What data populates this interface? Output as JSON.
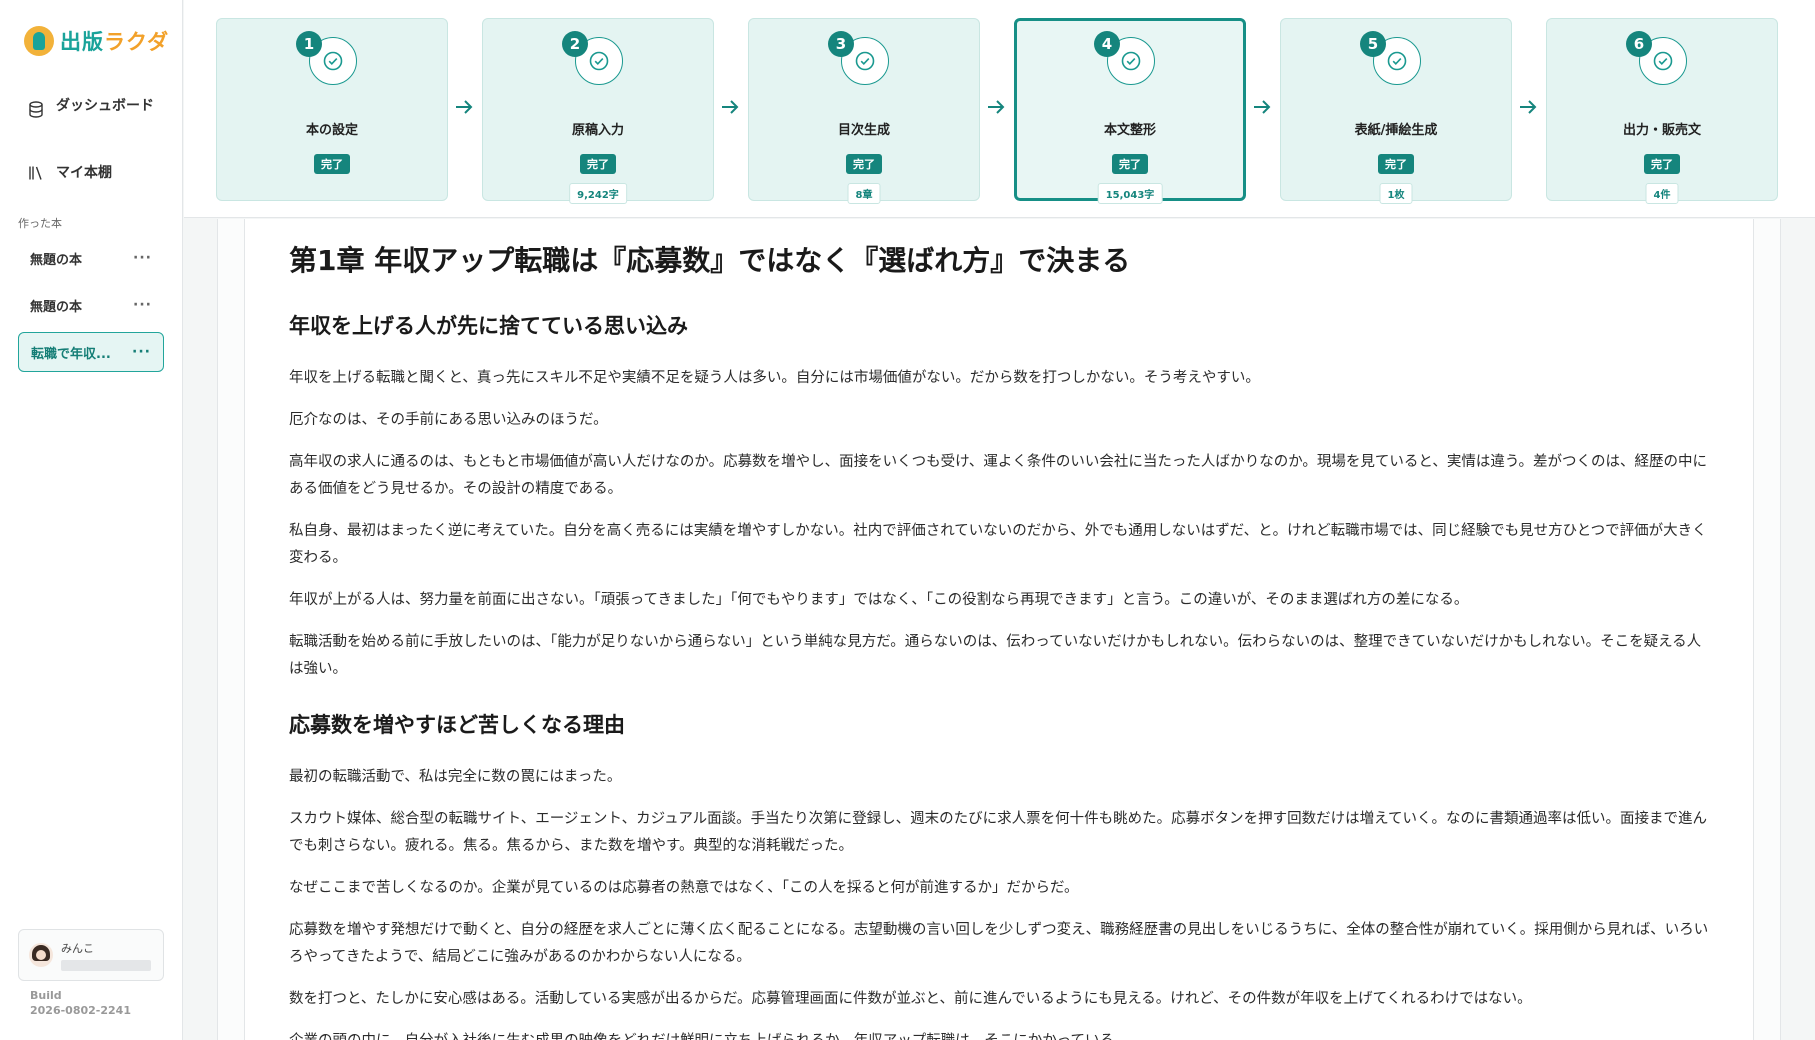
{
  "app": {
    "logo_main": "出版",
    "logo_accent": "ラクダ"
  },
  "sidebar": {
    "nav": [
      {
        "label": "ダッシュボード",
        "icon": "database-icon"
      },
      {
        "label": "マイ本棚",
        "icon": "bookshelf-icon"
      }
    ],
    "section_label": "作った本",
    "books": [
      {
        "label": "無題の本",
        "more": "···"
      },
      {
        "label": "無題の本",
        "more": "···"
      },
      {
        "label": "転職で年収...",
        "more": "···"
      }
    ],
    "user": {
      "name": "みんこ"
    },
    "build_label": "Build",
    "build_value": "2026-0802-2241"
  },
  "steps": [
    {
      "num": "1",
      "title": "本の設定",
      "status": "完了",
      "count": ""
    },
    {
      "num": "2",
      "title": "原稿入力",
      "status": "完了",
      "count": "9,242字"
    },
    {
      "num": "3",
      "title": "目次生成",
      "status": "完了",
      "count": "8章"
    },
    {
      "num": "4",
      "title": "本文整形",
      "status": "完了",
      "count": "15,043字"
    },
    {
      "num": "5",
      "title": "表紙/挿絵生成",
      "status": "完了",
      "count": "1枚"
    },
    {
      "num": "6",
      "title": "出力・販売文",
      "status": "完了",
      "count": "4件"
    }
  ],
  "colors": {
    "accent": "#15857d",
    "step_bg": "#e4f4f2",
    "logo_orange": "#f2a12a"
  },
  "document": {
    "chapter_title": "第1章 年収アップ転職は『応募数』ではなく『選ばれ方』で決まる",
    "section1_title": "年収を上げる人が先に捨てている思い込み",
    "section1_paragraphs": [
      "年収を上げる転職と聞くと、真っ先にスキル不足や実績不足を疑う人は多い。自分には市場価値がない。だから数を打つしかない。そう考えやすい。",
      "厄介なのは、その手前にある思い込みのほうだ。",
      "高年収の求人に通るのは、もともと市場価値が高い人だけなのか。応募数を増やし、面接をいくつも受け、運よく条件のいい会社に当たった人ばかりなのか。現場を見ていると、実情は違う。差がつくのは、経歴の中にある価値をどう見せるか。その設計の精度である。",
      "私自身、最初はまったく逆に考えていた。自分を高く売るには実績を増やすしかない。社内で評価されていないのだから、外でも通用しないはずだ、と。けれど転職市場では、同じ経験でも見せ方ひとつで評価が大きく変わる。",
      "年収が上がる人は、努力量を前面に出さない。「頑張ってきました」「何でもやります」ではなく、「この役割なら再現できます」と言う。この違いが、そのまま選ばれ方の差になる。",
      "転職活動を始める前に手放したいのは、「能力が足りないから通らない」という単純な見方だ。通らないのは、伝わっていないだけかもしれない。伝わらないのは、整理できていないだけかもしれない。そこを疑える人は強い。"
    ],
    "section2_title": "応募数を増やすほど苦しくなる理由",
    "section2_paragraphs": [
      "最初の転職活動で、私は完全に数の罠にはまった。",
      "スカウト媒体、総合型の転職サイト、エージェント、カジュアル面談。手当たり次第に登録し、週末のたびに求人票を何十件も眺めた。応募ボタンを押す回数だけは増えていく。なのに書類通過率は低い。面接まで進んでも刺さらない。疲れる。焦る。焦るから、また数を増やす。典型的な消耗戦だった。",
      "なぜここまで苦しくなるのか。企業が見ているのは応募者の熱意ではなく、「この人を採ると何が前進するか」だからだ。",
      "応募数を増やす発想だけで動くと、自分の経歴を求人ごとに薄く広く配ることになる。志望動機の言い回しを少しずつ変え、職務経歴書の見出しをいじるうちに、全体の整合性が崩れていく。採用側から見れば、いろいろやってきたようで、結局どこに強みがあるのかわからない人になる。",
      "数を打つと、たしかに安心感はある。活動している実感が出るからだ。応募管理画面に件数が並ぶと、前に進んでいるようにも見える。けれど、その件数が年収を上げてくれるわけではない。",
      "企業の頭の中に、自分が入社後に生む成果の映像をどれだけ鮮明に立ち上げられるか。年収アップ転職は、そこにかかっている。"
    ]
  }
}
